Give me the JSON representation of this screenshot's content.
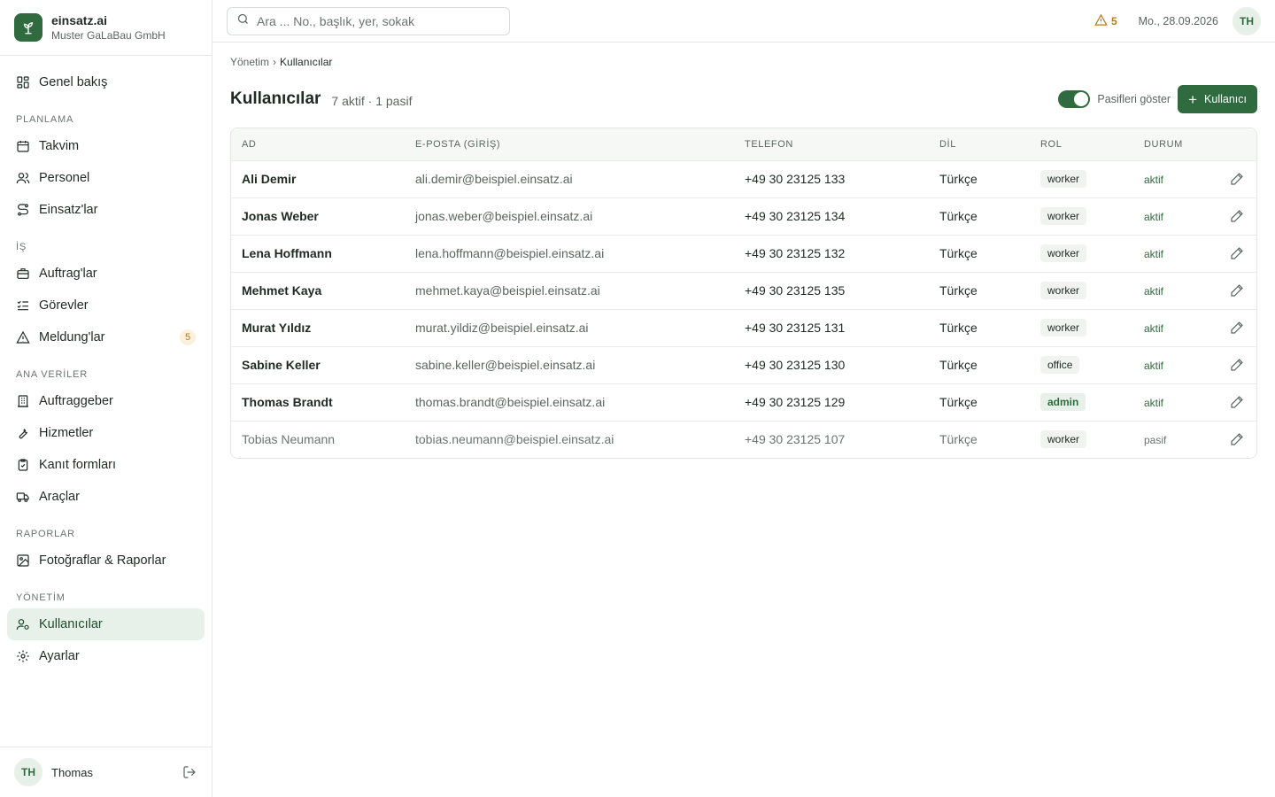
{
  "brand": {
    "name": "einsatz.ai",
    "company": "Muster GaLaBau GmbH"
  },
  "nav": {
    "overview": "Genel bakış",
    "sections": {
      "planlama": "PLANLAMA",
      "is": "İŞ",
      "ana": "ANA VERİLER",
      "raporlar": "RAPORLAR",
      "yonetim": "YÖNETİM"
    },
    "takvim": "Takvim",
    "personel": "Personel",
    "einsatzlar": "Einsatz'lar",
    "auftraglar": "Auftrag'lar",
    "gorevler": "Görevler",
    "meldunglar": "Meldung'lar",
    "meldung_badge": "5",
    "auftraggeber": "Auftraggeber",
    "hizmetler": "Hizmetler",
    "kanit": "Kanıt formları",
    "araclar": "Araçlar",
    "fotograflar": "Fotoğraflar & Raporlar",
    "kullanicilar": "Kullanıcılar",
    "ayarlar": "Ayarlar"
  },
  "user": {
    "initials": "TH",
    "name": "Thomas"
  },
  "topbar": {
    "search_placeholder": "Ara ... No., başlık, yer, sokak",
    "alert_count": "5",
    "date": "Mo., 28.09.2026",
    "avatar": "TH"
  },
  "breadcrumb": {
    "parent": "Yönetim",
    "separator": "›",
    "current": "Kullanıcılar"
  },
  "page": {
    "title": "Kullanıcılar",
    "subtitle": "7 aktif · 1 pasif",
    "toggle_label": "Pasifleri göster",
    "add_button": "Kullanıcı"
  },
  "table": {
    "headers": {
      "name": "AD",
      "email": "E-POSTA (GİRİŞ)",
      "phone": "TELEFON",
      "lang": "DİL",
      "role": "ROL",
      "status": "DURUM"
    },
    "rows": [
      {
        "name": "Ali Demir",
        "email": "ali.demir@beispiel.einsatz.ai",
        "phone": "+49 30 23125 133",
        "lang": "Türkçe",
        "role": "worker",
        "status": "aktif"
      },
      {
        "name": "Jonas Weber",
        "email": "jonas.weber@beispiel.einsatz.ai",
        "phone": "+49 30 23125 134",
        "lang": "Türkçe",
        "role": "worker",
        "status": "aktif"
      },
      {
        "name": "Lena Hoffmann",
        "email": "lena.hoffmann@beispiel.einsatz.ai",
        "phone": "+49 30 23125 132",
        "lang": "Türkçe",
        "role": "worker",
        "status": "aktif"
      },
      {
        "name": "Mehmet Kaya",
        "email": "mehmet.kaya@beispiel.einsatz.ai",
        "phone": "+49 30 23125 135",
        "lang": "Türkçe",
        "role": "worker",
        "status": "aktif"
      },
      {
        "name": "Murat Yıldız",
        "email": "murat.yildiz@beispiel.einsatz.ai",
        "phone": "+49 30 23125 131",
        "lang": "Türkçe",
        "role": "worker",
        "status": "aktif"
      },
      {
        "name": "Sabine Keller",
        "email": "sabine.keller@beispiel.einsatz.ai",
        "phone": "+49 30 23125 130",
        "lang": "Türkçe",
        "role": "office",
        "status": "aktif"
      },
      {
        "name": "Thomas Brandt",
        "email": "thomas.brandt@beispiel.einsatz.ai",
        "phone": "+49 30 23125 129",
        "lang": "Türkçe",
        "role": "admin",
        "status": "aktif"
      },
      {
        "name": "Tobias Neumann",
        "email": "tobias.neumann@beispiel.einsatz.ai",
        "phone": "+49 30 23125 107",
        "lang": "Türkçe",
        "role": "worker",
        "status": "pasif"
      }
    ]
  },
  "colors": {
    "primary": "#2f6b3f",
    "active_bg": "#e7f1e9",
    "warning": "#b7791f"
  },
  "icons": {
    "logo": "plant-icon",
    "search": "search-icon",
    "alert": "warning-triangle-icon",
    "edit": "pencil-icon",
    "logout": "logout-icon"
  }
}
